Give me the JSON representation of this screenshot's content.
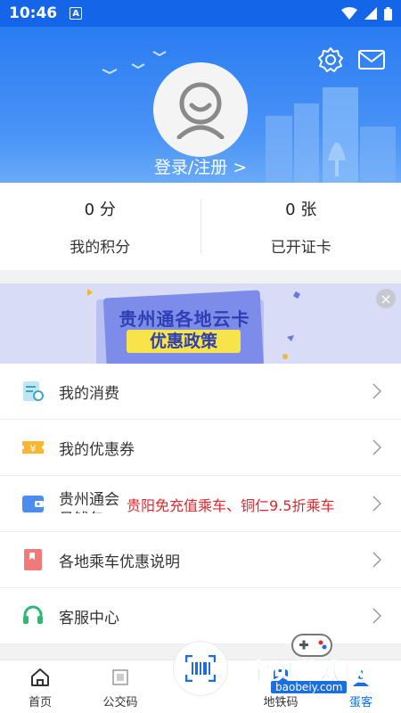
{
  "status_bar": {
    "time": "10:46",
    "a_badge": "A"
  },
  "header": {
    "login_label": "登录/注册 >"
  },
  "stats": [
    {
      "value": "0 分",
      "label": "我的积分"
    },
    {
      "value": "0 张",
      "label": "已开证卡"
    }
  ],
  "banner": {
    "title_line1": "贵州通各地云卡",
    "title_line2": "优惠政策",
    "close_glyph": "×"
  },
  "menu": [
    {
      "label": "我的消费",
      "icon": "receipt-icon"
    },
    {
      "label": "我的优惠券",
      "icon": "coupon-icon"
    },
    {
      "label": "贵州通会员钱包",
      "icon": "wallet-icon",
      "promo": "贵阳免充值乘车、铜仁9.5折乘车"
    },
    {
      "label": "各地乘车优惠说明",
      "icon": "bookmark-icon"
    },
    {
      "label": "客服中心",
      "icon": "headset-icon"
    }
  ],
  "bottom_nav": [
    {
      "label": "首页",
      "icon": "home-icon"
    },
    {
      "label": "公交码",
      "icon": "qr-icon"
    },
    {
      "label": "地铁码",
      "icon": "metro-icon"
    },
    {
      "label": "蛋客",
      "icon": "user-icon"
    }
  ],
  "watermark": {
    "text": "宝贝游戏网",
    "url": "baobeiy.com"
  },
  "colors": {
    "primary": "#2a7cf2",
    "promo_red": "#e0272d",
    "banner_bg": "#d9dcf5"
  }
}
